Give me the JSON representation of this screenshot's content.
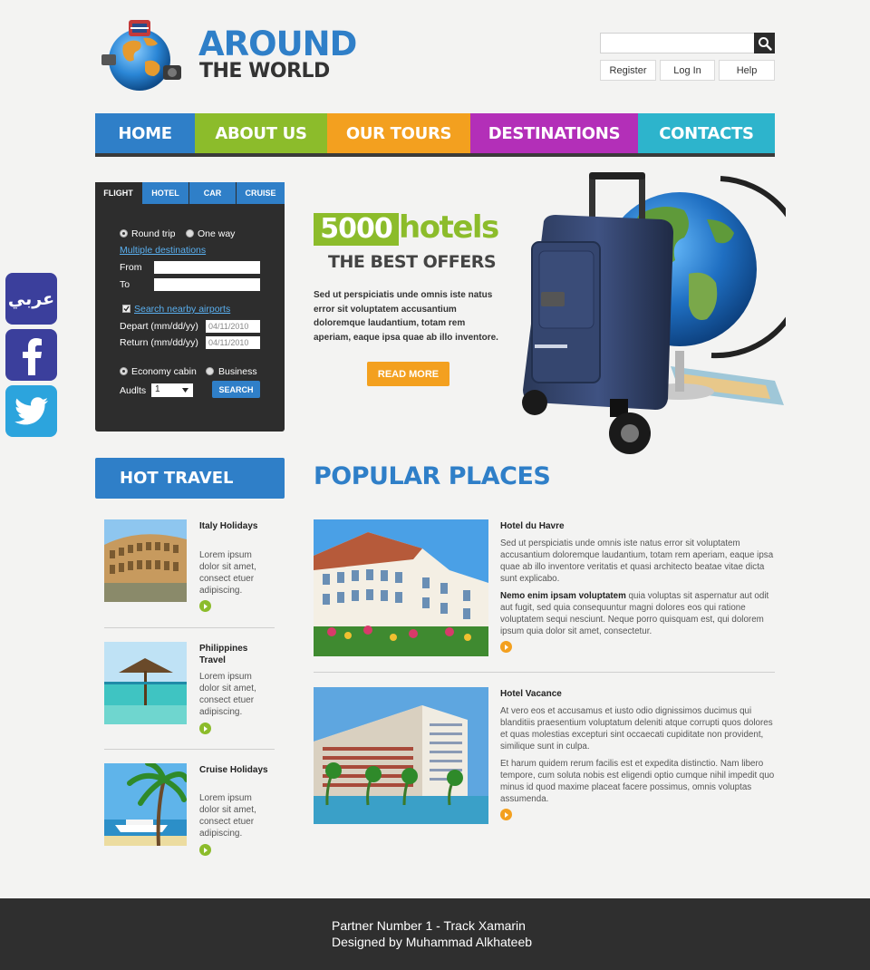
{
  "logo": {
    "title": "AROUND",
    "subtitle": "THE WORLD"
  },
  "header": {
    "search_placeholder": "",
    "links": [
      "Register",
      "Log In",
      "Help"
    ]
  },
  "nav": {
    "items": [
      {
        "label": "HOME",
        "color": "#2f7fc8"
      },
      {
        "label": "ABOUT US",
        "color": "#8cbc2b"
      },
      {
        "label": "OUR TOURS",
        "color": "#f3a01f"
      },
      {
        "label": "DESTINATIONS",
        "color": "#b32fb8"
      },
      {
        "label": "CONTACTS",
        "color": "#2db4cc"
      }
    ]
  },
  "social": {
    "arabic_label": "عربي",
    "facebook_icon": "facebook-icon",
    "twitter_icon": "twitter-icon"
  },
  "booking": {
    "tabs": [
      "FLIGHT",
      "HOTEL",
      "CAR",
      "CRUISE"
    ],
    "round_trip": "Round trip",
    "one_way": "One way",
    "multiple_destinations": "Multiple destinations",
    "from_label": "From",
    "to_label": "To",
    "nearby_airports": "Search nearby airports",
    "depart_label": "Depart (mm/dd/yy)",
    "depart_value": "04/11/2010",
    "return_label": "Return (mm/dd/yy)",
    "return_value": "04/11/2010",
    "economy": "Economy cabin",
    "business": "Business",
    "adults_label": "Audlts",
    "adults_value": "1",
    "search_button": "SEARCH"
  },
  "promo": {
    "number": "5000",
    "word": "hotels",
    "subtitle": "THE BEST OFFERS",
    "text": "Sed ut perspiciatis unde omnis iste natus error sit voluptatem accusantium doloremque laudantium, totam rem aperiam, eaque ipsa quae ab illo inventore.",
    "button": "READ MORE"
  },
  "hot_travel": {
    "title": "HOT TRAVEL",
    "items": [
      {
        "title": "Italy Holidays",
        "desc": "Lorem ipsum dolor sit amet, consect etuer adipiscing."
      },
      {
        "title": "Philippines Travel",
        "desc": "Lorem ipsum dolor sit amet, consect etuer adipiscing."
      },
      {
        "title": "Cruise Holidays",
        "desc": "Lorem ipsum dolor sit amet, consect etuer adipiscing."
      }
    ]
  },
  "popular": {
    "title": "POPULAR PLACES",
    "places": [
      {
        "title": "Hotel du Havre",
        "p1": "Sed ut perspiciatis unde omnis iste natus error sit voluptatem accusantium doloremque laudantium, totam rem aperiam, eaque ipsa quae ab illo inventore veritatis et quasi architecto beatae vitae dicta sunt explicabo.",
        "p2_bold": "Nemo enim ipsam voluptatem",
        "p2": " quia voluptas sit aspernatur aut odit aut fugit, sed quia consequuntur magni dolores eos qui ratione voluptatem sequi nesciunt. Neque porro quisquam est, qui dolorem ipsum quia dolor sit amet, consectetur."
      },
      {
        "title": "Hotel Vacance",
        "p1": "At vero eos et accusamus et iusto odio dignissimos ducimus qui blanditiis praesentium voluptatum deleniti atque corrupti quos dolores et quas molestias excepturi sint occaecati cupiditate non provident, similique sunt in culpa.",
        "p2": "Et harum quidem rerum facilis est et expedita distinctio. Nam libero tempore, cum soluta nobis est eligendi optio cumque nihil impedit quo minus id quod maxime placeat facere possimus, omnis voluptas assumenda."
      }
    ]
  },
  "footer": {
    "line1": "Partner Number 1 - Track Xamarin",
    "line2": "Designed by Muhammad Alkhateeb"
  }
}
